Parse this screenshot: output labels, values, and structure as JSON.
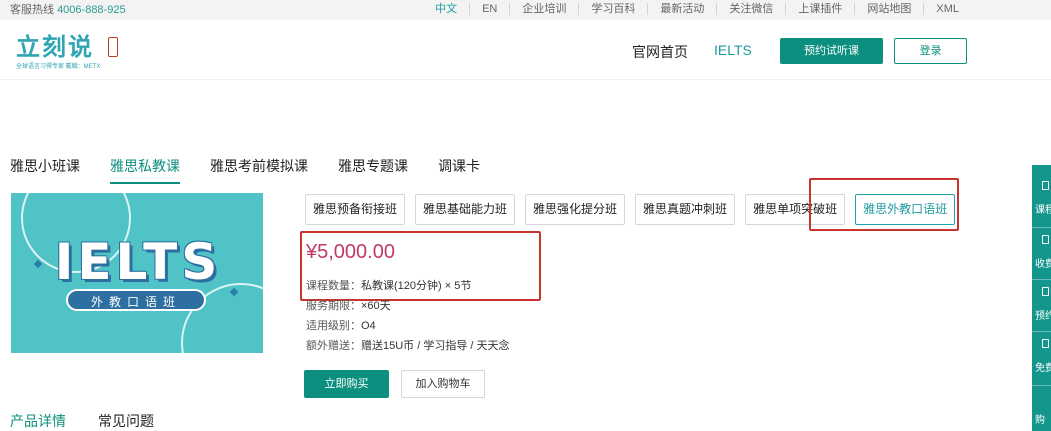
{
  "topbar": {
    "hotline_label": "客服热线",
    "hotline_number": "4006-888-925",
    "links": [
      "中文",
      "EN",
      "企业培训",
      "学习百科",
      "最新活动",
      "关注微信",
      "上课插件",
      "网站地图",
      "XML"
    ]
  },
  "header": {
    "logo_text": "立刻说",
    "logo_sub": "全球语言习得专家  戴翰：METX",
    "nav_home": "官网首页",
    "nav_ielts": "IELTS",
    "trial_button": "预约试听课",
    "login_button": "登录"
  },
  "course_tabs": [
    {
      "label": "雅思小班课"
    },
    {
      "label": "雅思私教课"
    },
    {
      "label": "雅思考前模拟课"
    },
    {
      "label": "雅思专题课"
    },
    {
      "label": "调课卡"
    }
  ],
  "banner": {
    "title": "IELTS",
    "subtitle": "外教口语班"
  },
  "subcourses": [
    {
      "label": "雅思预备衔接班"
    },
    {
      "label": "雅思基础能力班"
    },
    {
      "label": "雅思强化提分班"
    },
    {
      "label": "雅思真题冲刺班"
    },
    {
      "label": "雅思单项突破班"
    },
    {
      "label": "雅思外教口语班"
    }
  ],
  "product": {
    "price": "¥5,000.00",
    "course_count_label": "课程数量：",
    "course_count_value": "私教课(120分钟) × 5节",
    "service_label": "服务期限：",
    "service_value": "×60天",
    "level_label": "适用级别：",
    "level_value": "O4",
    "gift_label": "额外赠送：",
    "gift_value": "赠送15U币 / 学习指导 / 天天念"
  },
  "actions": {
    "buy_now": "立即购买",
    "add_cart": "加入购物车"
  },
  "detail_tabs": [
    "产品详情",
    "常见问题"
  ],
  "side_float": [
    "课程",
    "收费",
    "预约",
    "免费",
    "购"
  ],
  "colors": {
    "brand_green": "#0c8f7e",
    "accent_teal": "#1f9aa0",
    "price_color": "#c0396b",
    "highlight_red": "#c9342f"
  }
}
